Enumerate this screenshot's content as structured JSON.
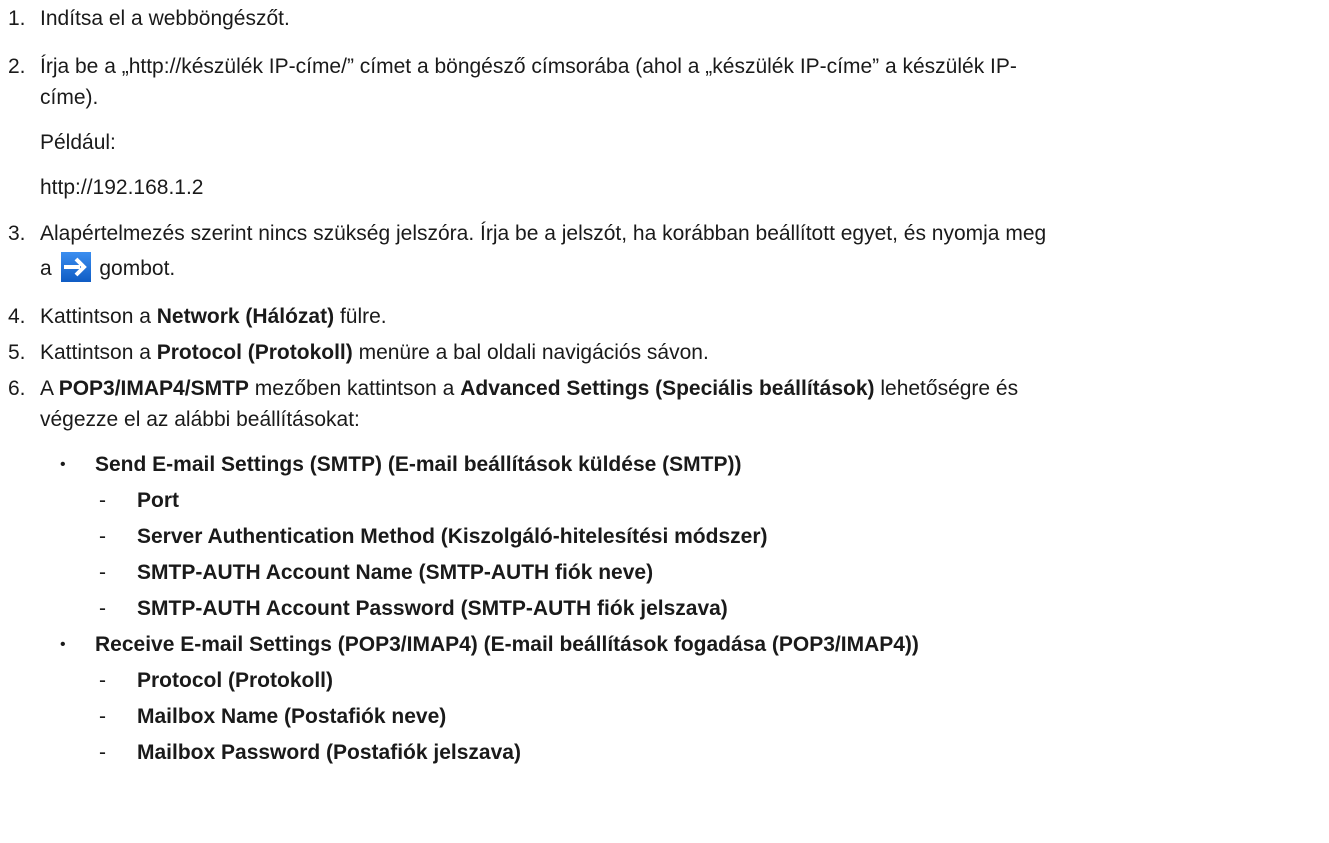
{
  "steps": [
    {
      "num": "1.",
      "text": "Indítsa el a webböngészőt."
    },
    {
      "num": "2.",
      "line1": "Írja be a „http://készülék IP-címe/” címet a böngésző címsorába (ahol a „készülék IP-címe” a készülék IP-",
      "line2": "címe).",
      "example_label": "Például:",
      "example_url": "http://192.168.1.2"
    },
    {
      "num": "3.",
      "line1": "Alapértelmezés szerint nincs szükség jelszóra. Írja be a jelszót, ha korábban beállított egyet, és nyomja meg",
      "line2_pre": "a",
      "line2_post": "gombot.",
      "icon": "arrow-right-icon",
      "icon_color": "#1a73d9"
    },
    {
      "num": "4.",
      "pre": "Kattintson a ",
      "bold": "Network (Hálózat)",
      "post": " fülre."
    },
    {
      "num": "5.",
      "pre": "Kattintson a ",
      "bold": "Protocol (Protokoll)",
      "post": " menüre a bal oldali navigációs sávon."
    },
    {
      "num": "6.",
      "pre": "A ",
      "bold1": "POP3/IMAP4/SMTP",
      "mid": " mezőben kattintson a ",
      "bold2": "Advanced Settings (Speciális beállítások)",
      "post": " lehetőségre és",
      "line2": "végezze el az alábbi beállításokat:"
    }
  ],
  "groups": [
    {
      "bullet": "•",
      "title": "Send E-mail Settings (SMTP) (E-mail beállítások küldése (SMTP))",
      "items": [
        "Port",
        "Server Authentication Method (Kiszolgáló-hitelesítési módszer)",
        "SMTP-AUTH Account Name (SMTP-AUTH fiók neve)",
        "SMTP-AUTH Account Password (SMTP-AUTH fiók jelszava)"
      ]
    },
    {
      "bullet": "•",
      "title": "Receive E-mail Settings (POP3/IMAP4) (E-mail beállítások fogadása (POP3/IMAP4))",
      "items": [
        "Protocol (Protokoll)",
        "Mailbox Name (Postafiók neve)",
        "Mailbox Password (Postafiók jelszava)"
      ]
    }
  ],
  "dash": "-"
}
